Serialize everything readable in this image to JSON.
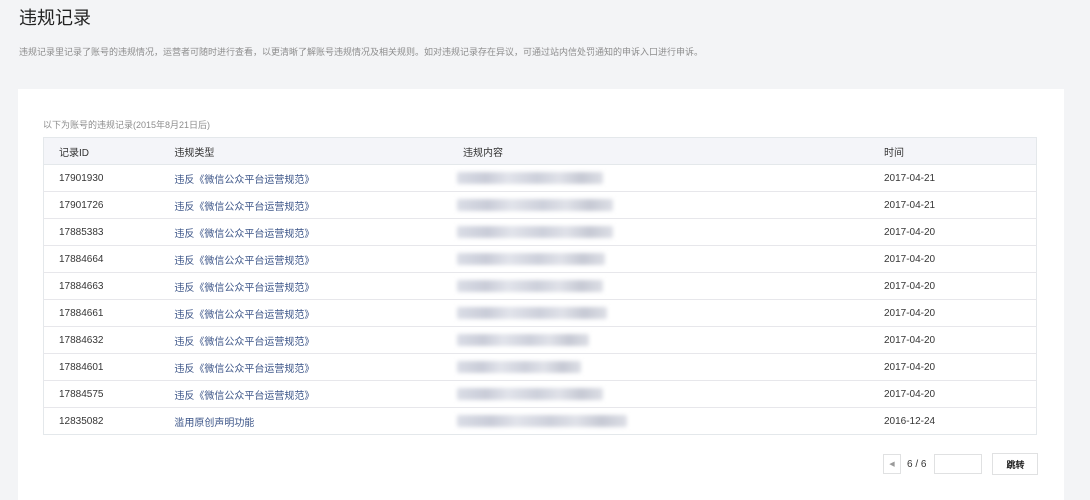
{
  "page": {
    "title": "违规记录",
    "description": "违规记录里记录了账号的违规情况，运营者可随时进行查看，以更清晰了解账号违规情况及相关规则。如对违规记录存在异议，可通过站内信处罚通知的申诉入口进行申诉。"
  },
  "records": {
    "caption": "以下为账号的违规记录(2015年8月21日后)",
    "headers": {
      "id": "记录ID",
      "type": "违规类型",
      "content": "违规内容",
      "time": "时间"
    },
    "rows": [
      {
        "id": "17901930",
        "type": "违反《微信公众平台运营规范》",
        "time": "2017-04-21"
      },
      {
        "id": "17901726",
        "type": "违反《微信公众平台运营规范》",
        "time": "2017-04-21"
      },
      {
        "id": "17885383",
        "type": "违反《微信公众平台运营规范》",
        "time": "2017-04-20"
      },
      {
        "id": "17884664",
        "type": "违反《微信公众平台运营规范》",
        "time": "2017-04-20"
      },
      {
        "id": "17884663",
        "type": "违反《微信公众平台运营规范》",
        "time": "2017-04-20"
      },
      {
        "id": "17884661",
        "type": "违反《微信公众平台运营规范》",
        "time": "2017-04-20"
      },
      {
        "id": "17884632",
        "type": "违反《微信公众平台运营规范》",
        "time": "2017-04-20"
      },
      {
        "id": "17884601",
        "type": "违反《微信公众平台运营规范》",
        "time": "2017-04-20"
      },
      {
        "id": "17884575",
        "type": "违反《微信公众平台运营规范》",
        "time": "2017-04-20"
      },
      {
        "id": "12835082",
        "type": "滥用原创声明功能",
        "time": "2016-12-24"
      }
    ]
  },
  "pagination": {
    "prev_icon": "chevron-left-icon",
    "page_indicator": "6 / 6",
    "input_value": "",
    "jump_label": "跳转"
  }
}
